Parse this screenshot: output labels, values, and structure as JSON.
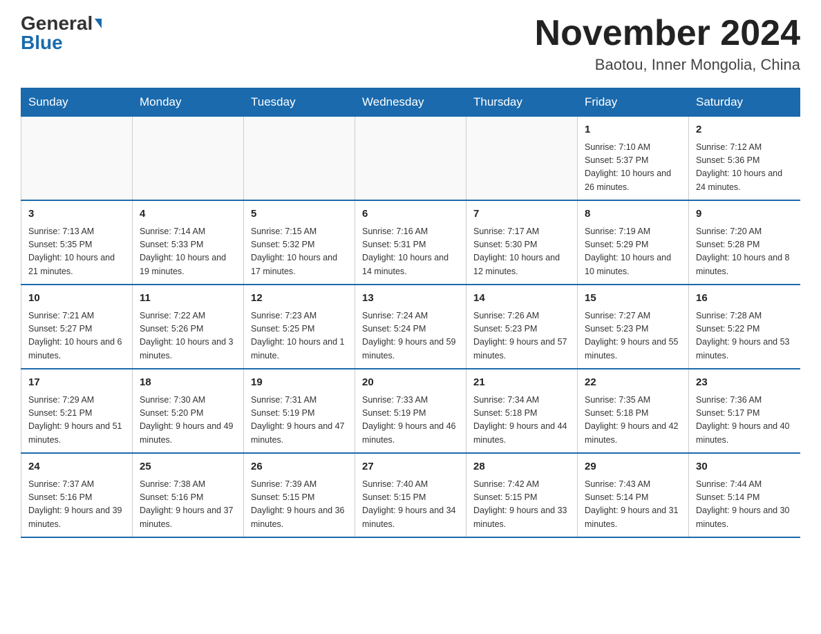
{
  "header": {
    "logo_general": "General",
    "logo_blue": "Blue",
    "month_title": "November 2024",
    "location": "Baotou, Inner Mongolia, China"
  },
  "days_of_week": [
    "Sunday",
    "Monday",
    "Tuesday",
    "Wednesday",
    "Thursday",
    "Friday",
    "Saturday"
  ],
  "weeks": [
    [
      {
        "day": "",
        "info": ""
      },
      {
        "day": "",
        "info": ""
      },
      {
        "day": "",
        "info": ""
      },
      {
        "day": "",
        "info": ""
      },
      {
        "day": "",
        "info": ""
      },
      {
        "day": "1",
        "info": "Sunrise: 7:10 AM\nSunset: 5:37 PM\nDaylight: 10 hours and 26 minutes."
      },
      {
        "day": "2",
        "info": "Sunrise: 7:12 AM\nSunset: 5:36 PM\nDaylight: 10 hours and 24 minutes."
      }
    ],
    [
      {
        "day": "3",
        "info": "Sunrise: 7:13 AM\nSunset: 5:35 PM\nDaylight: 10 hours and 21 minutes."
      },
      {
        "day": "4",
        "info": "Sunrise: 7:14 AM\nSunset: 5:33 PM\nDaylight: 10 hours and 19 minutes."
      },
      {
        "day": "5",
        "info": "Sunrise: 7:15 AM\nSunset: 5:32 PM\nDaylight: 10 hours and 17 minutes."
      },
      {
        "day": "6",
        "info": "Sunrise: 7:16 AM\nSunset: 5:31 PM\nDaylight: 10 hours and 14 minutes."
      },
      {
        "day": "7",
        "info": "Sunrise: 7:17 AM\nSunset: 5:30 PM\nDaylight: 10 hours and 12 minutes."
      },
      {
        "day": "8",
        "info": "Sunrise: 7:19 AM\nSunset: 5:29 PM\nDaylight: 10 hours and 10 minutes."
      },
      {
        "day": "9",
        "info": "Sunrise: 7:20 AM\nSunset: 5:28 PM\nDaylight: 10 hours and 8 minutes."
      }
    ],
    [
      {
        "day": "10",
        "info": "Sunrise: 7:21 AM\nSunset: 5:27 PM\nDaylight: 10 hours and 6 minutes."
      },
      {
        "day": "11",
        "info": "Sunrise: 7:22 AM\nSunset: 5:26 PM\nDaylight: 10 hours and 3 minutes."
      },
      {
        "day": "12",
        "info": "Sunrise: 7:23 AM\nSunset: 5:25 PM\nDaylight: 10 hours and 1 minute."
      },
      {
        "day": "13",
        "info": "Sunrise: 7:24 AM\nSunset: 5:24 PM\nDaylight: 9 hours and 59 minutes."
      },
      {
        "day": "14",
        "info": "Sunrise: 7:26 AM\nSunset: 5:23 PM\nDaylight: 9 hours and 57 minutes."
      },
      {
        "day": "15",
        "info": "Sunrise: 7:27 AM\nSunset: 5:23 PM\nDaylight: 9 hours and 55 minutes."
      },
      {
        "day": "16",
        "info": "Sunrise: 7:28 AM\nSunset: 5:22 PM\nDaylight: 9 hours and 53 minutes."
      }
    ],
    [
      {
        "day": "17",
        "info": "Sunrise: 7:29 AM\nSunset: 5:21 PM\nDaylight: 9 hours and 51 minutes."
      },
      {
        "day": "18",
        "info": "Sunrise: 7:30 AM\nSunset: 5:20 PM\nDaylight: 9 hours and 49 minutes."
      },
      {
        "day": "19",
        "info": "Sunrise: 7:31 AM\nSunset: 5:19 PM\nDaylight: 9 hours and 47 minutes."
      },
      {
        "day": "20",
        "info": "Sunrise: 7:33 AM\nSunset: 5:19 PM\nDaylight: 9 hours and 46 minutes."
      },
      {
        "day": "21",
        "info": "Sunrise: 7:34 AM\nSunset: 5:18 PM\nDaylight: 9 hours and 44 minutes."
      },
      {
        "day": "22",
        "info": "Sunrise: 7:35 AM\nSunset: 5:18 PM\nDaylight: 9 hours and 42 minutes."
      },
      {
        "day": "23",
        "info": "Sunrise: 7:36 AM\nSunset: 5:17 PM\nDaylight: 9 hours and 40 minutes."
      }
    ],
    [
      {
        "day": "24",
        "info": "Sunrise: 7:37 AM\nSunset: 5:16 PM\nDaylight: 9 hours and 39 minutes."
      },
      {
        "day": "25",
        "info": "Sunrise: 7:38 AM\nSunset: 5:16 PM\nDaylight: 9 hours and 37 minutes."
      },
      {
        "day": "26",
        "info": "Sunrise: 7:39 AM\nSunset: 5:15 PM\nDaylight: 9 hours and 36 minutes."
      },
      {
        "day": "27",
        "info": "Sunrise: 7:40 AM\nSunset: 5:15 PM\nDaylight: 9 hours and 34 minutes."
      },
      {
        "day": "28",
        "info": "Sunrise: 7:42 AM\nSunset: 5:15 PM\nDaylight: 9 hours and 33 minutes."
      },
      {
        "day": "29",
        "info": "Sunrise: 7:43 AM\nSunset: 5:14 PM\nDaylight: 9 hours and 31 minutes."
      },
      {
        "day": "30",
        "info": "Sunrise: 7:44 AM\nSunset: 5:14 PM\nDaylight: 9 hours and 30 minutes."
      }
    ]
  ]
}
